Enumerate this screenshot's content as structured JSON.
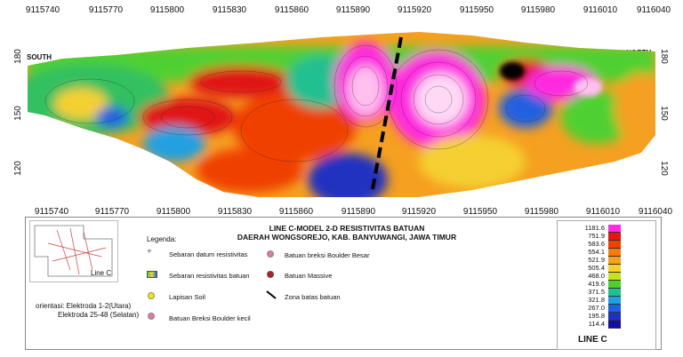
{
  "x_ticks": [
    "9115740",
    "9115770",
    "9115800",
    "9115830",
    "9115860",
    "9115890",
    "9115920",
    "9115950",
    "9115980",
    "9116010",
    "9116040"
  ],
  "y_ticks": [
    "180",
    "150",
    "120"
  ],
  "direction_left": "SOUTH",
  "direction_right": "NORTH",
  "title_line1": "LINE C-MODEL 2-D RESISTIVITAS BATUAN",
  "title_line2": "DAERAH WONGSOREJO, KAB. BANYUWANGI, JAWA TIMUR",
  "inset_label": "Line C",
  "orientation_line1": "orientasi: Elektroda 1-2(Utara)",
  "orientation_line2": "Elektroda 25-48 (Selatan)",
  "legend_title": "Legenda:",
  "legend": {
    "datum": "Sebaran datum resistivitas",
    "sebaran": "Sebaran resistivitas batuan",
    "soil": "Lapisan Soil",
    "breksi_kecil": "Batuan Breksi Boulder kecil",
    "breksi_besar": "Batuan breksi Boulder Besar",
    "massive": "Batuan Massive",
    "zona": "Zona batas batuan"
  },
  "colors": {
    "soil": "#f5e600",
    "breksi_kecil": "#e07a9a",
    "breksi_besar": "#e07a9a",
    "massive": "#b82020"
  },
  "colorbar_values": [
    "1181.6",
    "751.9",
    "583.6",
    "554.1",
    "521.9",
    "505.4",
    "468.0",
    "419.6",
    "371.5",
    "321.8",
    "267.0",
    "195.8",
    "114.4"
  ],
  "colorbar_colors": [
    "#ff2be0",
    "#e01818",
    "#f04000",
    "#f57a10",
    "#f5a020",
    "#f5d030",
    "#c8e020",
    "#50d030",
    "#20c090",
    "#20a0e0",
    "#2060e0",
    "#2030c0",
    "#1010a0"
  ],
  "colorbar_title": "LINE C"
}
